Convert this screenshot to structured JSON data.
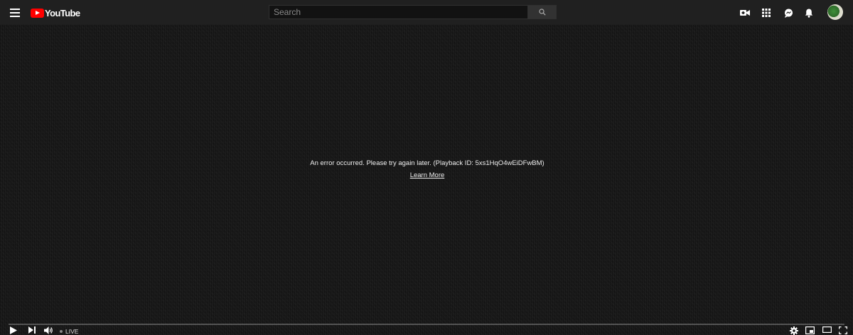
{
  "masthead": {
    "logo_text": "YouTube",
    "search_placeholder": "Search",
    "brand_color": "#ff0000",
    "background": "#202020",
    "icons": [
      "menu-icon",
      "search-icon",
      "create-video-icon",
      "apps-grid-icon",
      "messages-icon",
      "notifications-bell-icon"
    ]
  },
  "player": {
    "error_message": "An error occurred. Please try again later. (Playback ID: 5xs1HqO4wEiDFwBM)",
    "learn_more_label": "Learn More"
  },
  "controls": {
    "live_label": "LIVE",
    "icons": [
      "play-icon",
      "next-icon",
      "volume-icon",
      "settings-icon",
      "miniplayer-icon",
      "theater-mode-icon",
      "fullscreen-icon"
    ]
  }
}
